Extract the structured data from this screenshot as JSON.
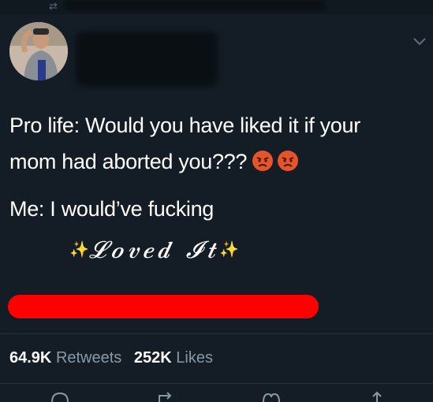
{
  "tweet": {
    "line1": "Pro life: Would you have liked it if your",
    "line2": "mom had aborted you???",
    "line3": "Me: I would’ve fucking",
    "loved": "𝓛𝒐𝒗𝒆𝒅 𝓘𝒕",
    "sparkle": "✨",
    "emoji_icon": "angry-face-icon"
  },
  "stats": {
    "retweets_count": "64.9K",
    "retweets_label": "Retweets",
    "likes_count": "252K",
    "likes_label": "Likes"
  },
  "colors": {
    "background": "#141d26",
    "muted_text": "#8899a6",
    "redaction_bar": "#ff0000",
    "emoji_face": "#e8542a"
  }
}
